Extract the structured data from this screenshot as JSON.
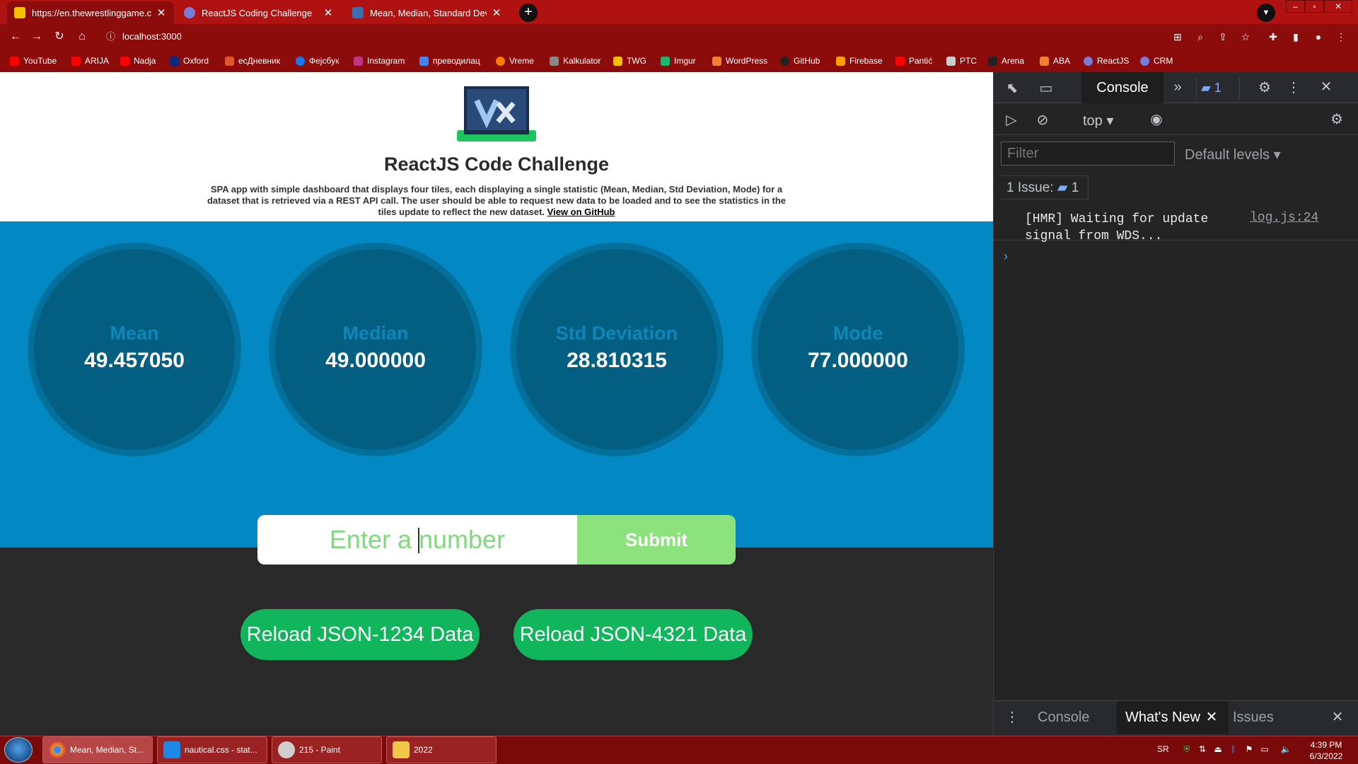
{
  "browser": {
    "tabs": [
      {
        "title": "https://en.thewrestlinggame.com",
        "favicon_color": "#f6c000",
        "active": true
      },
      {
        "title": "ReactJS Coding Challenge",
        "favicon_color": "#7b7bd8",
        "active": false
      },
      {
        "title": "Mean, Median, Standard Deviatio",
        "favicon_color": "#3a6fb0",
        "active": false
      }
    ],
    "url": "localhost:3000",
    "bookmarks": [
      {
        "label": "YouTube",
        "color": "#ff0000"
      },
      {
        "label": "ARIJA",
        "color": "#ff0000"
      },
      {
        "label": "Nadja",
        "color": "#ff0000"
      },
      {
        "label": "Oxford",
        "color": "#0a2a80"
      },
      {
        "label": "есДневник",
        "color": "#e2562c"
      },
      {
        "label": "Фејсбук",
        "color": "#1877f2"
      },
      {
        "label": "Instagram",
        "color": "#c13584"
      },
      {
        "label": "преводилац",
        "color": "#4285f4"
      },
      {
        "label": "Vreme",
        "color": "#ff7a00"
      },
      {
        "label": "Kalkulator",
        "color": "#888888"
      },
      {
        "label": "TWG",
        "color": "#f6c000"
      },
      {
        "label": "Imgur",
        "color": "#1bb76e"
      },
      {
        "label": "WordPress",
        "color": "#f08030"
      },
      {
        "label": "GitHub",
        "color": "#222222"
      },
      {
        "label": "Firebase",
        "color": "#ffa000"
      },
      {
        "label": "Pantić",
        "color": "#ff0000"
      },
      {
        "label": "PTC",
        "color": "#cccccc"
      },
      {
        "label": "Arena",
        "color": "#222222"
      },
      {
        "label": "ABA",
        "color": "#f08030"
      },
      {
        "label": "ReactJS",
        "color": "#7b7bd8"
      },
      {
        "label": "CRM",
        "color": "#7b7bd8"
      }
    ]
  },
  "app": {
    "title": "ReactJS Code Challenge",
    "description": "SPA app with simple dashboard that displays four tiles, each displaying a single statistic (Mean, Median, Std Deviation, Mode) for a dataset that is retrieved via a REST API call. The user should be able to request new data to be loaded and to see the statistics in the tiles update to reflect the new dataset.",
    "github_link": "View on GitHub",
    "tiles": [
      {
        "name": "Mean",
        "value": "49.457050"
      },
      {
        "name": "Median",
        "value": "49.000000"
      },
      {
        "name": "Std Deviation",
        "value": "28.810315"
      },
      {
        "name": "Mode",
        "value": "77.000000"
      }
    ],
    "input_placeholder": "Enter a number",
    "submit_label": "Submit",
    "reload_buttons": [
      "Reload JSON-1234 Data",
      "Reload JSON-4321 Data"
    ]
  },
  "devtools": {
    "active_tab": "Console",
    "issue_count": "1",
    "context": "top",
    "filter_placeholder": "Filter",
    "levels": "Default levels",
    "issues_label": "1 Issue:",
    "log_message": "[HMR] Waiting for update signal from WDS...",
    "log_source": "log.js:24",
    "drawer_tabs": [
      "Console",
      "What's New",
      "Issues"
    ]
  },
  "taskbar": {
    "items": [
      {
        "label": "Mean, Median, St...",
        "color": "#e8a020"
      },
      {
        "label": "nautical.css - stat...",
        "color": "#1e88e5"
      },
      {
        "label": "215 - Paint",
        "color": "#cfcfcf"
      },
      {
        "label": "2022",
        "color": "#f3c84a"
      }
    ],
    "lang": "SR",
    "time": "4:39 PM",
    "date": "6/3/2022"
  }
}
